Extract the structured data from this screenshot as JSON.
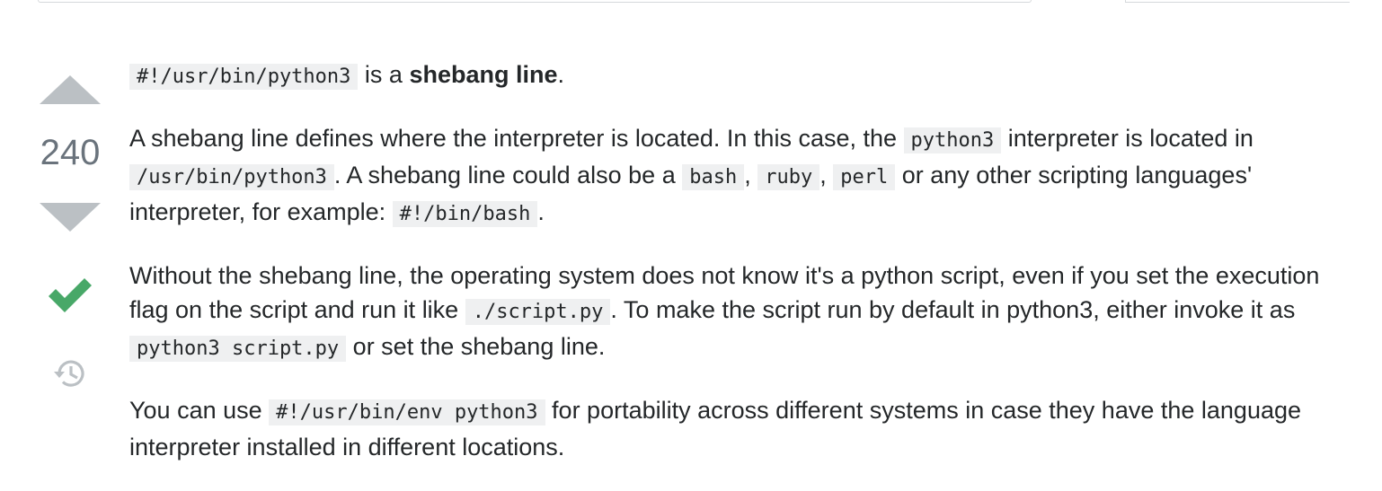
{
  "vote": {
    "count": "240",
    "up_icon": "arrow-up-icon",
    "down_icon": "arrow-down-icon",
    "accepted_icon": "checkmark-icon",
    "history_icon": "history-icon",
    "accepted_color": "#48a868",
    "arrow_color": "#bbc0c4"
  },
  "post": {
    "p1": {
      "code1": "#!/usr/bin/python3",
      "t1": " is a ",
      "bold1": "shebang line",
      "t2": "."
    },
    "p2": {
      "t1": "A shebang line defines where the interpreter is located. In this case, the ",
      "code1": "python3",
      "t2": " interpreter is located in ",
      "code2": "/usr/bin/python3",
      "t3": ". A shebang line could also be a ",
      "code3": "bash",
      "t4": ", ",
      "code4": "ruby",
      "t5": ", ",
      "code5": "perl",
      "t6": " or any other scripting languages' interpreter, for example: ",
      "code6": "#!/bin/bash",
      "t7": "."
    },
    "p3": {
      "t1": "Without the shebang line, the operating system does not know it's a python script, even if you set the execution flag on the script and run it like ",
      "code1": "./script.py",
      "t2": ". To make the script run by default in python3, either invoke it as ",
      "code2": "python3 script.py",
      "t3": " or set the shebang line."
    },
    "p4": {
      "t1": "You can use ",
      "code1": "#!/usr/bin/env python3",
      "t2": " for portability across different systems in case they have the language interpreter installed in different locations."
    }
  }
}
